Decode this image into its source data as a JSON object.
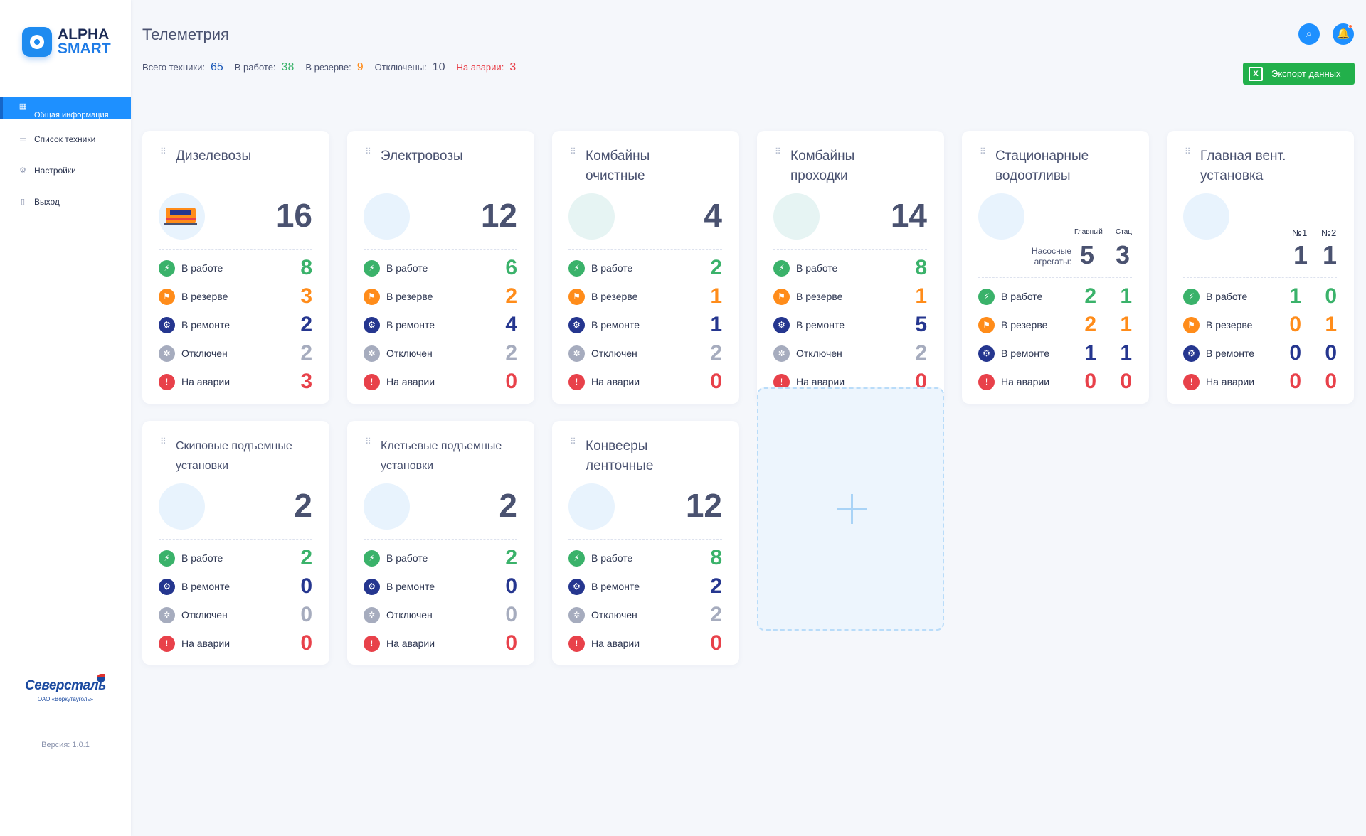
{
  "logo": {
    "line1": "ALPHA",
    "line2": "SMART"
  },
  "nav": [
    {
      "label": "Общая информация",
      "icon": "dashboard-icon"
    },
    {
      "label": "Список техники",
      "icon": "list-icon"
    },
    {
      "label": "Настройки",
      "icon": "gear-icon"
    },
    {
      "label": "Выход",
      "icon": "door-icon"
    }
  ],
  "brand": {
    "name": "Северсталь",
    "sub": "ОАО «Воркутауголь»"
  },
  "version": "Версия: 1.0.1",
  "header": {
    "title": "Телеметрия"
  },
  "stats": [
    {
      "label": "Всего техники:",
      "value": "65",
      "color": "#1e5bb8"
    },
    {
      "label": "В работе:",
      "value": "38",
      "color": "#3ab26a"
    },
    {
      "label": "В резерве:",
      "value": "9",
      "color": "#ff8c1a"
    },
    {
      "label": "Отключены:",
      "value": "10",
      "color": "#4a5270"
    },
    {
      "label": "На аварии:",
      "value": "3",
      "color": "#e8414a"
    }
  ],
  "export_label": "Экспорт данных",
  "status_labels": {
    "work": "В работе",
    "res": "В резерве",
    "rep": "В ремонте",
    "off": "Отключен",
    "acc": "На аварии"
  },
  "cards": [
    {
      "title": "Дизелевозы",
      "total": "16",
      "work": "8",
      "res": "3",
      "rep": "2",
      "off": "2",
      "acc": "3"
    },
    {
      "title": "Электровозы",
      "total": "12",
      "work": "6",
      "res": "2",
      "rep": "4",
      "off": "2",
      "acc": "0"
    },
    {
      "title": "Комбайны очистные",
      "total": "4",
      "work": "2",
      "res": "1",
      "rep": "1",
      "off": "2",
      "acc": "0"
    },
    {
      "title": "Комбайны проходки",
      "total": "14",
      "work": "8",
      "res": "1",
      "rep": "5",
      "off": "2",
      "acc": "0"
    },
    {
      "title": "Стационарные водоотливы",
      "col1": "Главный",
      "col2": "Стац",
      "pump_label": "Насосные агрегаты:",
      "pump1": "5",
      "pump2": "3",
      "work1": "2",
      "work2": "1",
      "res1": "2",
      "res2": "1",
      "rep1": "1",
      "rep2": "1",
      "acc1": "0",
      "acc2": "0"
    },
    {
      "title": "Главная вент. установка",
      "col1": "№1",
      "col2": "№2",
      "v1": "1",
      "v2": "1",
      "work1": "1",
      "work2": "0",
      "res1": "0",
      "res2": "1",
      "rep1": "0",
      "rep2": "0",
      "acc1": "0",
      "acc2": "0"
    },
    {
      "title": "Скиповые подъемные установки",
      "total": "2",
      "work": "2",
      "rep": "0",
      "off": "0",
      "acc": "0"
    },
    {
      "title": "Клетьевые подъемные установки",
      "total": "2",
      "work": "2",
      "rep": "0",
      "off": "0",
      "acc": "0"
    },
    {
      "title": "Конвееры ленточные",
      "total": "12",
      "work": "8",
      "rep": "2",
      "off": "2",
      "acc": "0"
    }
  ]
}
